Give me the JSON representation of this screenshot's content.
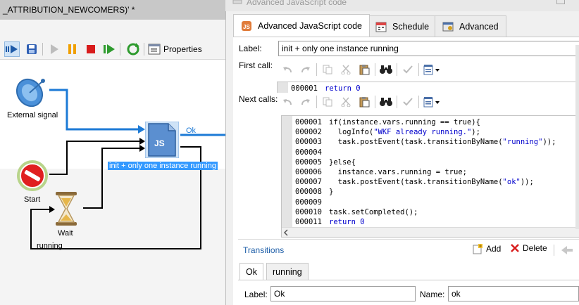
{
  "editor": {
    "document_tab": "_ATTRIBUTION_NEWCOMERS)' *",
    "toolbar": {
      "properties_label": "Properties"
    },
    "nodes": {
      "external_signal": "External signal",
      "start": "Start",
      "wait": "Wait",
      "js_activity": "init + only one instance running"
    },
    "transitions": {
      "ok": "Ok",
      "running": "running"
    }
  },
  "dialog": {
    "title": "Advanced JavaScript code",
    "tabs": [
      {
        "label": "Advanced JavaScript code",
        "icon": "js-icon"
      },
      {
        "label": "Schedule",
        "icon": "calendar-icon"
      },
      {
        "label": "Advanced",
        "icon": "advanced-icon"
      }
    ],
    "label_field": {
      "label": "Label:",
      "value": "init + only one instance running"
    },
    "first_call": {
      "label": "First call:",
      "lines": [
        {
          "num": "000001",
          "code": "return 0"
        }
      ]
    },
    "next_calls": {
      "label": "Next calls:",
      "lines": [
        {
          "num": "000001",
          "code": "if(instance.vars.running == true){"
        },
        {
          "num": "000002",
          "code": "  logInfo(\"WKF already running.\");"
        },
        {
          "num": "000003",
          "code": "  task.postEvent(task.transitionByName(\"running\"));"
        },
        {
          "num": "000004",
          "code": ""
        },
        {
          "num": "000005",
          "code": "}else{"
        },
        {
          "num": "000006",
          "code": "  instance.vars.running = true;"
        },
        {
          "num": "000007",
          "code": "  task.postEvent(task.transitionByName(\"ok\"));"
        },
        {
          "num": "000008",
          "code": "}"
        },
        {
          "num": "000009",
          "code": ""
        },
        {
          "num": "000010",
          "code": "task.setCompleted();"
        },
        {
          "num": "000011",
          "code": "return 0"
        }
      ]
    },
    "transitions": {
      "title": "Transitions",
      "add_label": "Add",
      "delete_label": "Delete",
      "tabs": [
        "Ok",
        "running"
      ],
      "label_field": {
        "label": "Label:",
        "value": "Ok"
      },
      "name_field": {
        "label": "Name:",
        "value": "ok"
      }
    }
  }
}
